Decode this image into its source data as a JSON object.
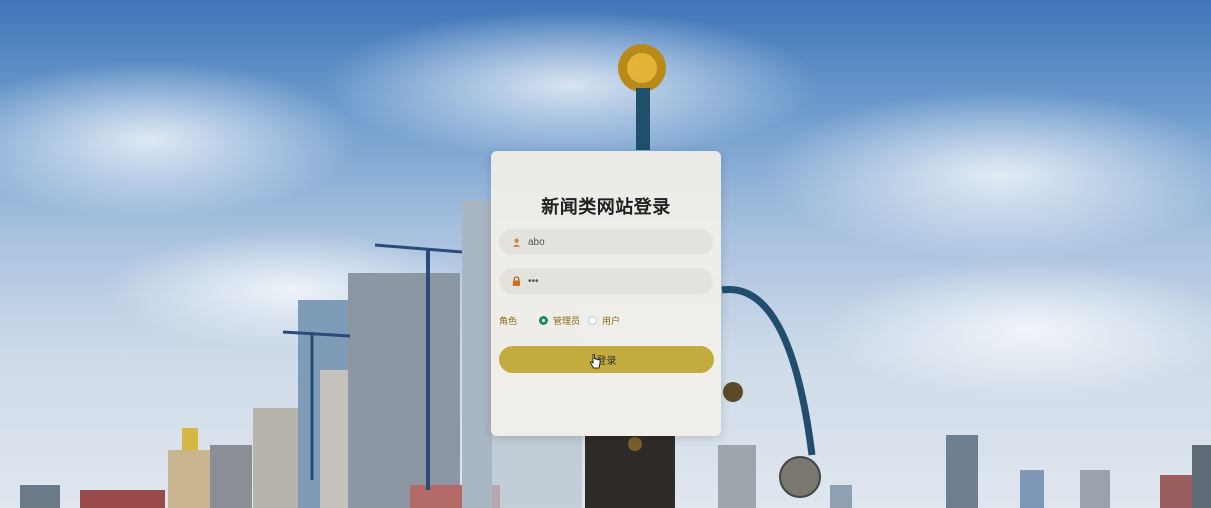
{
  "login": {
    "title": "新闻类网站登录",
    "username_value": "abo",
    "password_value": "•••",
    "role_label": "角色",
    "roles": [
      "管理员",
      "用户"
    ],
    "selected_role": "管理员",
    "button_label": "登录",
    "accent_color": "#c3ab3e",
    "radio_color": "#1f8a5a"
  }
}
